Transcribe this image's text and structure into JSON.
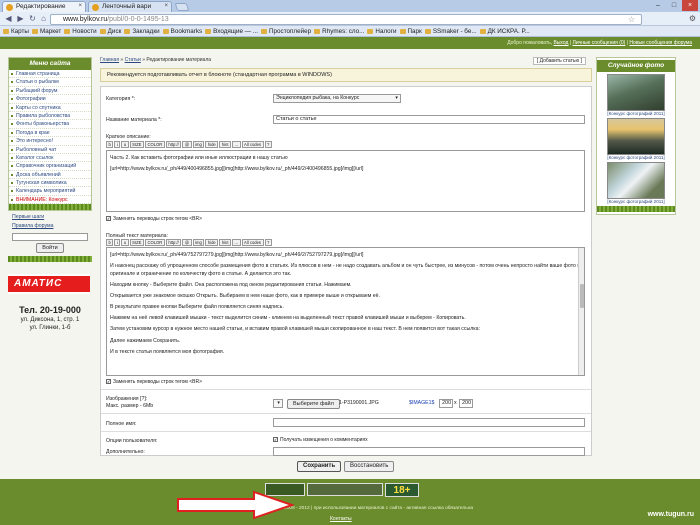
{
  "browser": {
    "tabs": [
      {
        "label": "Редактирование"
      },
      {
        "label": "Ленточный вари"
      }
    ],
    "url_host": "www.bylkov.ru",
    "url_path": "/publ/0-0-0-1495-13",
    "bookmarks": [
      "Карты",
      "Маркет",
      "Новости",
      "Диск",
      "Закладки",
      "Bookmarks",
      "Входящие — ...",
      "Простоплейер",
      "Rhymes: сло...",
      "Налоги",
      "Парк",
      "SSmaker - бе...",
      "ДК ИСКРА. Р..."
    ],
    "min_icon": "minimize-icon",
    "max_icon": "maximize-icon",
    "close_icon": "close-icon"
  },
  "header": {
    "welcome": "Добро пожаловать",
    "links": [
      "Выход",
      "Личные сообщения (0)",
      "Новые сообщения форума"
    ]
  },
  "sidebar": {
    "title": "Меню сайта",
    "items": [
      {
        "label": "Главная страница"
      },
      {
        "label": "Статьи о рыбалке"
      },
      {
        "label": "Рыбацкий форум"
      },
      {
        "label": "Фотографии"
      },
      {
        "label": "Карты со спутника"
      },
      {
        "label": "Правила рыболовства"
      },
      {
        "label": "Фонты браконьерства"
      },
      {
        "label": "Погода в крае"
      },
      {
        "label": "Это интересно!"
      },
      {
        "label": "Рыболовный чат"
      },
      {
        "label": "Каталог ссылок"
      },
      {
        "label": "Справочник организаций"
      },
      {
        "label": "Доска объявлений"
      },
      {
        "label": "Тугунская символика"
      },
      {
        "label": "Календарь мероприятий"
      },
      {
        "label": "ВНИМАНИЕ: Конкурс"
      }
    ],
    "first_steps": "Первые шаги",
    "forum_rules": "Правила форума",
    "login_button": "Войти",
    "ad_logo": "АМАТИС",
    "tel": "Тел. 20-19-000",
    "addr1": "ул. Диксона, 1, стр. 1",
    "addr2": "ул. Глинки, 1-б"
  },
  "breadcrumb": {
    "home": "Главная",
    "section": "Статьи",
    "current": "Редактирование материала",
    "add_link": "Добавить статью"
  },
  "notice": "Рекомендуется подготавливать отчет в блокноте (стандартная программа в WINDOWS)",
  "form": {
    "category_label": "Категория *:",
    "category_value": "Энциклопедия рыбака, на Конкурс",
    "title_label": "Название материала *:",
    "title_value": "Статьи о статье",
    "short_label": "Краткое описание:",
    "toolbar": [
      "b",
      "i",
      "u",
      "SIZE",
      "COLOR",
      "http://",
      "@",
      "img",
      "hide",
      "hint",
      "...",
      "All codes",
      "?"
    ],
    "short_lines": [
      "Часть 2. Как вставить фотографии или иные иллюстрации в нашу статью",
      "[url=http://www.bylkov.ru/_ph/449/400496855.jpg][img]http://www.bylkov.ru/_ph/449/2/400496855.jpg[/img][/url]"
    ],
    "replace_breaks": "Заменять переводы строк тегом <BR>",
    "full_label": "Полный текст материала:",
    "full_paragraphs": [
      "[url=http://www.bylkov.ru/_ph/449/752797279.jpg][img]http://www.bylkov.ru/_ph/449/2/752797279.jpg[/img][/url]",
      "И наконец расскажу об упрощенном способе размещения фото в статьях. Из плюсов в нем - не надо создавать альбом и он чуть быстрее, из минусов - потом очень непросто найти ваше фото в оригинале и ограничение по количеству фото в статье. А делается это так.",
      "Находим кнопку - Выберите файл. Она расположена под окном редактирования статьи. Нажимаем.",
      "Открывается уже знакомое окошко Открыть. Выбираем в нем наше фото, как в примере выше и открываем её.",
      "В результате правее кнопки Выберите файл появляется синяя надпись.",
      "Нажмем на неё левой клавишей мышки - текст выделится синим - кликнем на выделенный текст правой клавишей мыши и выберем - Копировать.",
      "Затем установим курсор в нужное место нашей статьи, и вставим правой клавишей мыши скопированное в наш текст. В нем появится вот такая ссылка:",
      "Далее нажимаем Сохранить.",
      "И в тексте статьи появляется моя фотография."
    ],
    "images_label": "Изображения [?]:",
    "images_sub": "Макс. размер - 6Mb",
    "choose_file": "Выберите файл",
    "file_name": "1-P3190001.JPG",
    "image_tag": "$IMAGE1$",
    "width_value": "200",
    "height_value": "200",
    "fullname_label": "Полное имя:",
    "options_label": "Опции пользователя:",
    "notify_label": "Получать извещения о комментариях",
    "extra_label": "Дополнительно:",
    "save_button": "Сохранить",
    "restore_button": "Восстановить"
  },
  "photos": {
    "title": "Случайное фото",
    "items": [
      {
        "caption": "[Конкурс фотографий 2011]"
      },
      {
        "caption": "[Конкурс фотографий 2011]"
      },
      {
        "caption": "[Конкурс фотографий 2011]"
      }
    ]
  },
  "footer": {
    "copyright": "Copyright www.tugun.ru © 2008 - 2012 | при использовании материалов с сайта - активная ссылка обязательна",
    "contacts": "Контакты",
    "site": "www.tugun.ru",
    "badge": "18+"
  },
  "colors": {
    "brand_green": "#6b8c2c",
    "arrow_red": "#e02020"
  }
}
